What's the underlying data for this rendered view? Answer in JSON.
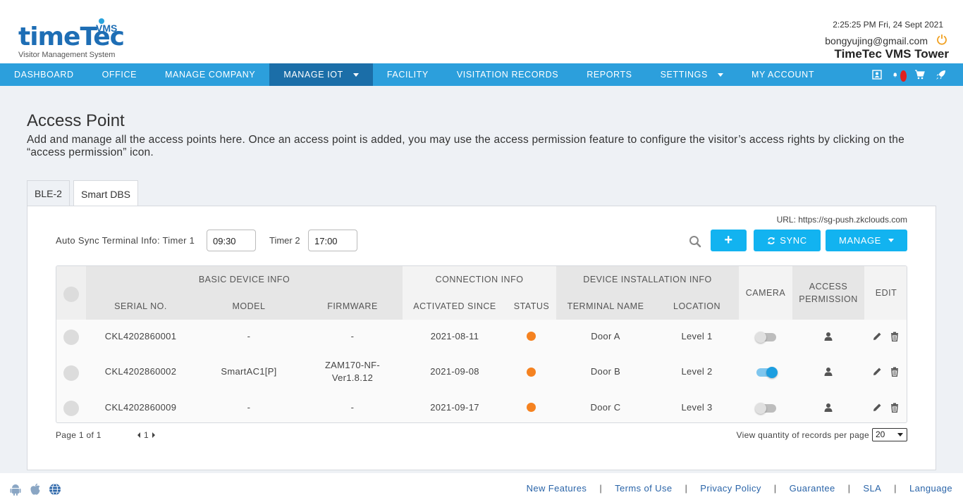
{
  "header": {
    "logo_brand": "timeTec",
    "logo_vms": "VMS",
    "logo_tagline": "Visitor Management System",
    "time": "2:25:25 PM  Fri, 24 Sept 2021",
    "email": "bongyujing@gmail.com",
    "company": "TimeTec VMS Tower"
  },
  "nav": {
    "items": [
      "DASHBOARD",
      "OFFICE",
      "MANAGE COMPANY",
      "MANAGE IOT",
      "FACILITY",
      "VISITATION RECORDS",
      "REPORTS",
      "SETTINGS",
      "MY ACCOUNT"
    ],
    "active": "MANAGE IOT"
  },
  "page": {
    "title": "Access Point",
    "description": "Add and manage all the access points here. Once an access point is added, you may use the access permission feature to configure the visitor’s access rights by clicking on the “access permission” icon."
  },
  "tabs": [
    "BLE-2",
    "Smart DBS"
  ],
  "toolbar": {
    "url": "URL: https://sg-push.zkclouds.com",
    "sync_label": "Auto Sync Terminal Info: Timer 1",
    "timer1": "09:30",
    "timer2_label": "Timer 2",
    "timer2": "17:00",
    "add_label": "+",
    "sync_button": "SYNC",
    "manage_button": "MANAGE"
  },
  "table": {
    "groups": {
      "basic": "BASIC DEVICE INFO",
      "connection": "CONNECTION INFO",
      "installation": "DEVICE INSTALLATION INFO"
    },
    "columns": {
      "serial": "SERIAL NO.",
      "model": "MODEL",
      "firmware": "FIRMWARE",
      "activated": "ACTIVATED SINCE",
      "status": "STATUS",
      "terminal": "TERMINAL NAME",
      "location": "LOCATION",
      "camera": "CAMERA",
      "access1": "ACCESS",
      "access2": "PERMISSION",
      "edit": "EDIT"
    },
    "rows": [
      {
        "serial": "CKL4202860001",
        "model": "-",
        "firmware1": "-",
        "firmware2": "",
        "activated": "2021-08-11",
        "terminal": "Door A",
        "location": "Level 1",
        "camera_on": false
      },
      {
        "serial": "CKL4202860002",
        "model": "SmartAC1[P]",
        "firmware1": "ZAM170-NF-",
        "firmware2": "Ver1.8.12",
        "activated": "2021-09-08",
        "terminal": "Door B",
        "location": "Level 2",
        "camera_on": true
      },
      {
        "serial": "CKL4202860009",
        "model": "-",
        "firmware1": "-",
        "firmware2": "",
        "activated": "2021-09-17",
        "terminal": "Door C",
        "location": "Level 3",
        "camera_on": false
      }
    ]
  },
  "pagination": {
    "page_info": "Page 1 of 1",
    "current": "1",
    "per_page_label": "View quantity of records per page",
    "per_page": "20"
  },
  "footer": {
    "links": [
      "New Features",
      "Terms of Use",
      "Privacy Policy",
      "Guarantee",
      "SLA",
      "Language"
    ]
  },
  "colors": {
    "nav": "#2c9fdc",
    "nav_active": "#1b6ea8",
    "button": "#12b3f0",
    "status": "#f58220"
  }
}
